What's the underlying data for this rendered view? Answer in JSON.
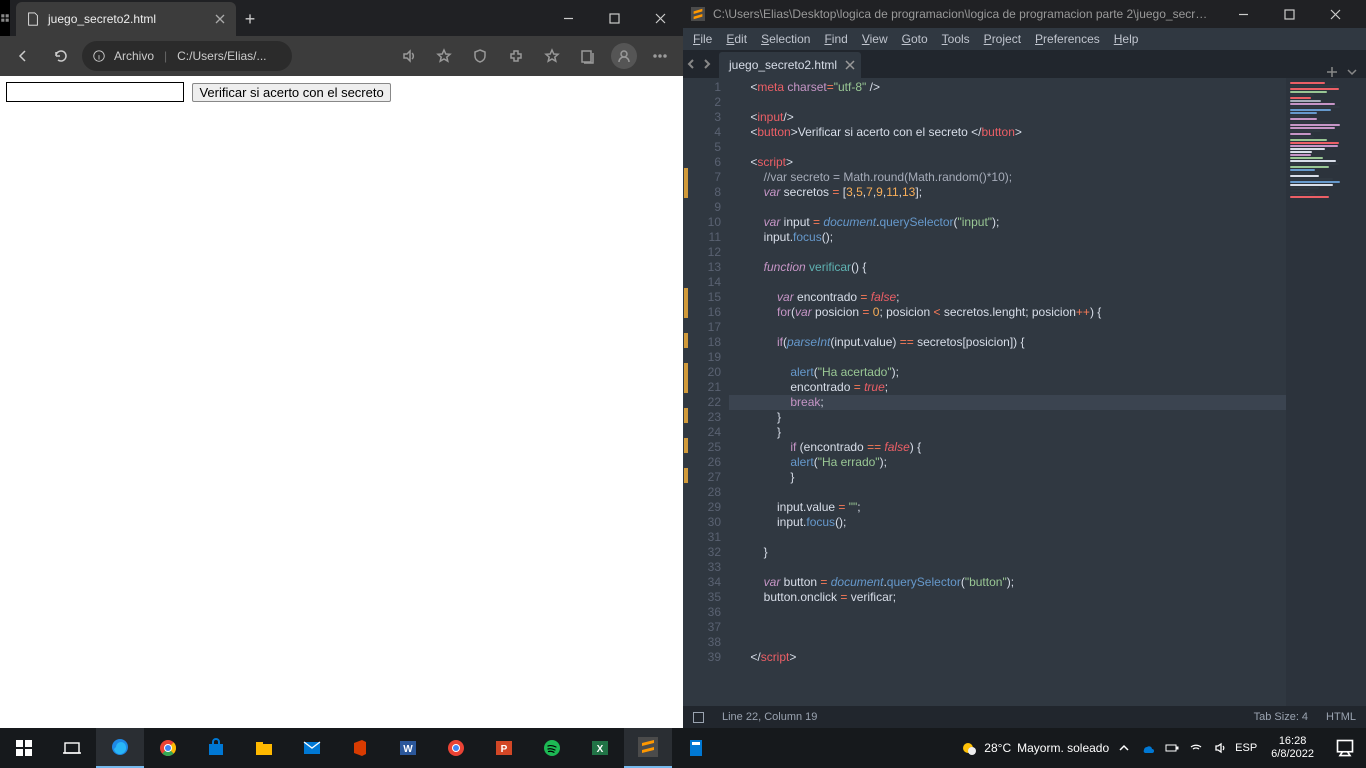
{
  "edge": {
    "tab_title": "juego_secreto2.html",
    "address_scheme": "Archivo",
    "address_path": "C:/Users/Elias/...",
    "page_button": "Verificar si acerto con el secreto"
  },
  "sublime": {
    "title_path": "C:\\Users\\Elias\\Desktop\\logica de programacion\\logica de programacion parte 2\\juego_secreto...",
    "menu": [
      "File",
      "Edit",
      "Selection",
      "Find",
      "View",
      "Goto",
      "Tools",
      "Project",
      "Preferences",
      "Help"
    ],
    "tab": "juego_secreto2.html",
    "status_cursor": "Line 22, Column 19",
    "status_tabsize": "Tab Size: 4",
    "status_syntax": "HTML",
    "active_line": 22,
    "line_count": 39,
    "modified_lines": [
      7,
      8,
      15,
      16,
      18,
      20,
      21,
      23,
      25,
      27
    ],
    "code_lines": [
      {
        "n": 1,
        "t": [
          [
            "    <",
            "def"
          ],
          [
            "meta",
            "tag"
          ],
          [
            " ",
            "def"
          ],
          [
            "charset",
            "attr"
          ],
          [
            "=",
            "op"
          ],
          [
            "\"utf-8\"",
            "str"
          ],
          [
            " /",
            "def"
          ],
          [
            ">",
            "def"
          ]
        ]
      },
      {
        "n": 2,
        "t": [
          [
            "",
            "def"
          ]
        ]
      },
      {
        "n": 3,
        "t": [
          [
            "    <",
            "def"
          ],
          [
            "input",
            "tag"
          ],
          [
            "/>",
            "def"
          ]
        ]
      },
      {
        "n": 4,
        "t": [
          [
            "    <",
            "def"
          ],
          [
            "button",
            "tag"
          ],
          [
            ">",
            "def"
          ],
          [
            "Verificar si acerto con el secreto ",
            "def"
          ],
          [
            "</",
            "def"
          ],
          [
            "button",
            "tag"
          ],
          [
            ">",
            "def"
          ]
        ]
      },
      {
        "n": 5,
        "t": [
          [
            "",
            "def"
          ]
        ]
      },
      {
        "n": 6,
        "t": [
          [
            "    <",
            "def"
          ],
          [
            "script",
            "tag"
          ],
          [
            ">",
            "def"
          ]
        ]
      },
      {
        "n": 7,
        "t": [
          [
            "        ",
            "def"
          ],
          [
            "//var secreto = Math.round(Math.random()*10);",
            "cmt"
          ]
        ]
      },
      {
        "n": 8,
        "t": [
          [
            "        ",
            "def"
          ],
          [
            "var",
            "kw"
          ],
          [
            " secretos ",
            "def"
          ],
          [
            "=",
            "op"
          ],
          [
            " [",
            "def"
          ],
          [
            "3",
            "num"
          ],
          [
            ",",
            "def"
          ],
          [
            "5",
            "num"
          ],
          [
            ",",
            "def"
          ],
          [
            "7",
            "num"
          ],
          [
            ",",
            "def"
          ],
          [
            "9",
            "num"
          ],
          [
            ",",
            "def"
          ],
          [
            "11",
            "num"
          ],
          [
            ",",
            "def"
          ],
          [
            "13",
            "num"
          ],
          [
            "];",
            "def"
          ]
        ]
      },
      {
        "n": 9,
        "t": [
          [
            "",
            "def"
          ]
        ]
      },
      {
        "n": 10,
        "t": [
          [
            "        ",
            "def"
          ],
          [
            "var",
            "kw"
          ],
          [
            " input ",
            "def"
          ],
          [
            "=",
            "op"
          ],
          [
            " ",
            "def"
          ],
          [
            "document",
            "obj"
          ],
          [
            ".",
            "def"
          ],
          [
            "querySelector",
            "fn"
          ],
          [
            "(",
            "def"
          ],
          [
            "\"input\"",
            "str"
          ],
          [
            ");",
            "def"
          ]
        ]
      },
      {
        "n": 11,
        "t": [
          [
            "        input.",
            "def"
          ],
          [
            "focus",
            "fn"
          ],
          [
            "();",
            "def"
          ]
        ]
      },
      {
        "n": 12,
        "t": [
          [
            "",
            "def"
          ]
        ]
      },
      {
        "n": 13,
        "t": [
          [
            "        ",
            "def"
          ],
          [
            "function",
            "kw"
          ],
          [
            " ",
            "def"
          ],
          [
            "verificar",
            "funcname"
          ],
          [
            "() {",
            "def"
          ]
        ]
      },
      {
        "n": 14,
        "t": [
          [
            "",
            "def"
          ]
        ]
      },
      {
        "n": 15,
        "t": [
          [
            "            ",
            "def"
          ],
          [
            "var",
            "kw"
          ],
          [
            " encontrado ",
            "def"
          ],
          [
            "=",
            "op"
          ],
          [
            " ",
            "def"
          ],
          [
            "false",
            "const"
          ],
          [
            ";",
            "def"
          ]
        ]
      },
      {
        "n": 16,
        "t": [
          [
            "            ",
            "def"
          ],
          [
            "for",
            "kw2"
          ],
          [
            "(",
            "def"
          ],
          [
            "var",
            "kw"
          ],
          [
            " posicion ",
            "def"
          ],
          [
            "=",
            "op"
          ],
          [
            " ",
            "def"
          ],
          [
            "0",
            "num"
          ],
          [
            "; posicion ",
            "def"
          ],
          [
            "<",
            "op"
          ],
          [
            " secretos.lenght; posicion",
            "def"
          ],
          [
            "++",
            "op"
          ],
          [
            ") {",
            "def"
          ]
        ]
      },
      {
        "n": 17,
        "t": [
          [
            "",
            "def"
          ]
        ]
      },
      {
        "n": 18,
        "t": [
          [
            "            ",
            "def"
          ],
          [
            "if",
            "kw2"
          ],
          [
            "(",
            "def"
          ],
          [
            "parseInt",
            "obj"
          ],
          [
            "(input.value) ",
            "def"
          ],
          [
            "==",
            "op"
          ],
          [
            " secretos[posicion]) {",
            "def"
          ]
        ]
      },
      {
        "n": 19,
        "t": [
          [
            "",
            "def"
          ]
        ]
      },
      {
        "n": 20,
        "t": [
          [
            "                ",
            "def"
          ],
          [
            "alert",
            "fn"
          ],
          [
            "(",
            "def"
          ],
          [
            "\"Ha acertado\"",
            "str"
          ],
          [
            ");",
            "def"
          ]
        ]
      },
      {
        "n": 21,
        "t": [
          [
            "                encontrado ",
            "def"
          ],
          [
            "=",
            "op"
          ],
          [
            " ",
            "def"
          ],
          [
            "true",
            "const"
          ],
          [
            ";",
            "def"
          ]
        ]
      },
      {
        "n": 22,
        "t": [
          [
            "                ",
            "def"
          ],
          [
            "break",
            "kw2"
          ],
          [
            ";",
            "def"
          ]
        ]
      },
      {
        "n": 23,
        "t": [
          [
            "            }",
            "def"
          ]
        ]
      },
      {
        "n": 24,
        "t": [
          [
            "            }",
            "def"
          ]
        ]
      },
      {
        "n": 25,
        "t": [
          [
            "                ",
            "def"
          ],
          [
            "if",
            "kw2"
          ],
          [
            " (encontrado ",
            "def"
          ],
          [
            "==",
            "op"
          ],
          [
            " ",
            "def"
          ],
          [
            "false",
            "const"
          ],
          [
            ") {",
            "def"
          ]
        ]
      },
      {
        "n": 26,
        "t": [
          [
            "                ",
            "def"
          ],
          [
            "alert",
            "fn"
          ],
          [
            "(",
            "def"
          ],
          [
            "\"Ha errado\"",
            "str"
          ],
          [
            ");",
            "def"
          ]
        ]
      },
      {
        "n": 27,
        "t": [
          [
            "                }",
            "def"
          ]
        ]
      },
      {
        "n": 28,
        "t": [
          [
            "",
            "def"
          ]
        ]
      },
      {
        "n": 29,
        "t": [
          [
            "            input.value ",
            "def"
          ],
          [
            "=",
            "op"
          ],
          [
            " ",
            "def"
          ],
          [
            "\"\"",
            "str"
          ],
          [
            ";",
            "def"
          ]
        ]
      },
      {
        "n": 30,
        "t": [
          [
            "            input.",
            "def"
          ],
          [
            "focus",
            "fn"
          ],
          [
            "();",
            "def"
          ]
        ]
      },
      {
        "n": 31,
        "t": [
          [
            "",
            "def"
          ]
        ]
      },
      {
        "n": 32,
        "t": [
          [
            "        }",
            "def"
          ]
        ]
      },
      {
        "n": 33,
        "t": [
          [
            "",
            "def"
          ]
        ]
      },
      {
        "n": 34,
        "t": [
          [
            "        ",
            "def"
          ],
          [
            "var",
            "kw"
          ],
          [
            " button ",
            "def"
          ],
          [
            "=",
            "op"
          ],
          [
            " ",
            "def"
          ],
          [
            "document",
            "obj"
          ],
          [
            ".",
            "def"
          ],
          [
            "querySelector",
            "fn"
          ],
          [
            "(",
            "def"
          ],
          [
            "\"button\"",
            "str"
          ],
          [
            ");",
            "def"
          ]
        ]
      },
      {
        "n": 35,
        "t": [
          [
            "        button.onclick ",
            "def"
          ],
          [
            "=",
            "op"
          ],
          [
            " verificar;",
            "def"
          ]
        ]
      },
      {
        "n": 36,
        "t": [
          [
            "",
            "def"
          ]
        ]
      },
      {
        "n": 37,
        "t": [
          [
            "",
            "def"
          ]
        ]
      },
      {
        "n": 38,
        "t": [
          [
            "",
            "def"
          ]
        ]
      },
      {
        "n": 39,
        "t": [
          [
            "    </",
            "def"
          ],
          [
            "script",
            "tag"
          ],
          [
            ">",
            "def"
          ]
        ]
      }
    ]
  },
  "taskbar": {
    "weather_temp": "28°C",
    "weather_label": "Mayorm. soleado",
    "lang": "ESP",
    "time": "16:28",
    "date": "6/8/2022"
  }
}
